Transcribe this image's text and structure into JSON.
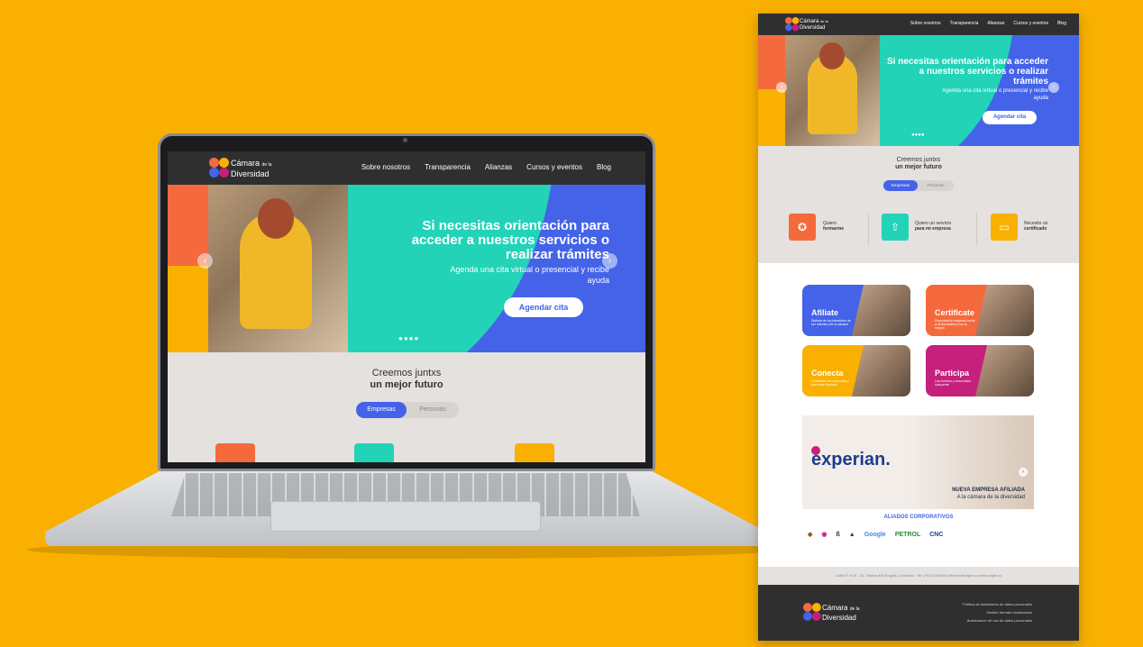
{
  "colors": {
    "background": "#f9b000",
    "accent_blue": "#4463e8",
    "teal": "#22d3b8",
    "orange": "#f46a3c",
    "pink": "#c4207c",
    "dark": "#2f2f2f"
  },
  "brand": {
    "line1": "Cámara",
    "small": "de la",
    "line2": "Diversidad"
  },
  "nav": {
    "items": [
      "Sobre nosotros",
      "Transparencia",
      "Alianzas",
      "Cursos y eventos",
      "Blog"
    ]
  },
  "hero": {
    "title": "Si necesitas orientación para acceder a nuestros servicios o realizar trámites",
    "subtitle": "Agenda una cita virtual o presencial y recibe ayuda",
    "cta": "Agendar cita",
    "prev_icon": "chevron-left-icon",
    "next_icon": "chevron-right-icon",
    "dots": "●●●●"
  },
  "future": {
    "line1": "Creemos juntxs",
    "line2": "un mejor futuro",
    "tab_active": "Empresas",
    "tab_inactive": "Personas"
  },
  "services": [
    {
      "label_a": "Quiero",
      "label_b": "formarme",
      "icon": "award-icon",
      "color": "#f46a3c"
    },
    {
      "label_a": "Quiero un servicio",
      "label_b": "para mi empresa",
      "icon": "rocket-icon",
      "color": "#22d3b8"
    },
    {
      "label_a": "Necesito un",
      "label_b": "certificado",
      "icon": "certificate-icon",
      "color": "#f9b000"
    }
  ],
  "cards": [
    {
      "title": "Afiliate",
      "desc": "Disfruta de los beneficios de ser miembro de la cámara",
      "color": "#4463e8"
    },
    {
      "title": "Certificate",
      "desc": "Empodera tu empresa frente a la diversidad y haz la segura",
      "color": "#f46a3c"
    },
    {
      "title": "Conecta",
      "desc": "Conéctate con empresas y personas diversas",
      "color": "#f9b000"
    },
    {
      "title": "Participa",
      "desc": "Los eventos y comunidad incluyente",
      "color": "#c4207c"
    }
  ],
  "banner": {
    "brand": "experian.",
    "line1": "NUEVA EMPRESA AFILIADA",
    "line2": "A la cámara de la diversidad"
  },
  "allies": {
    "title": "ALIADOS CORPORATIVOS",
    "logos": [
      "Google",
      "PETROL",
      "CNC"
    ]
  },
  "address": "Calle 97 # 10 - 24. Oficina 404 Bogotá, Colombia · Tel: (+57) 9260404 director@cclgbt.co www.cclgbt.co",
  "footer": {
    "links": [
      "Política de tratamiento de datos personales",
      "Modelo formato reclamación",
      "Autorización de uso de datos personales"
    ]
  }
}
